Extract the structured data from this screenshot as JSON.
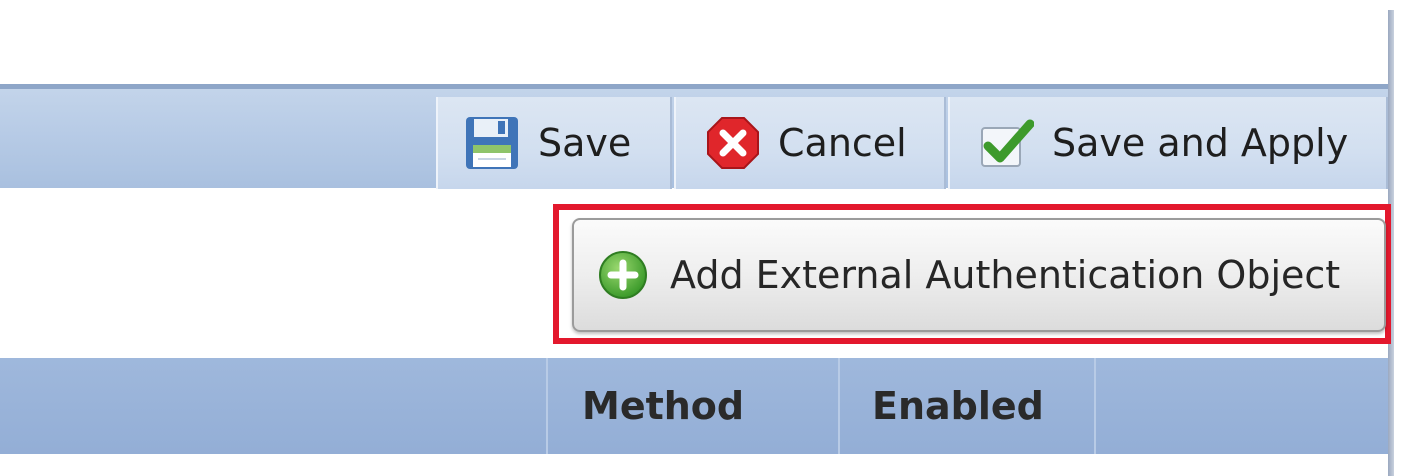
{
  "toolbar": {
    "save_label": "Save",
    "cancel_label": "Cancel",
    "save_apply_label": "Save and Apply"
  },
  "actions": {
    "add_external_auth_label": "Add External Authentication Object"
  },
  "table": {
    "columns": [
      "",
      "Method",
      "Enabled",
      ""
    ]
  },
  "icons": {
    "save": "floppy-disk-icon",
    "cancel": "red-x-icon",
    "save_apply": "green-check-icon",
    "add": "green-plus-icon"
  },
  "colors": {
    "highlight": "#e3182d",
    "toolbar": "#b7cbe6",
    "header": "#9bb4da"
  }
}
